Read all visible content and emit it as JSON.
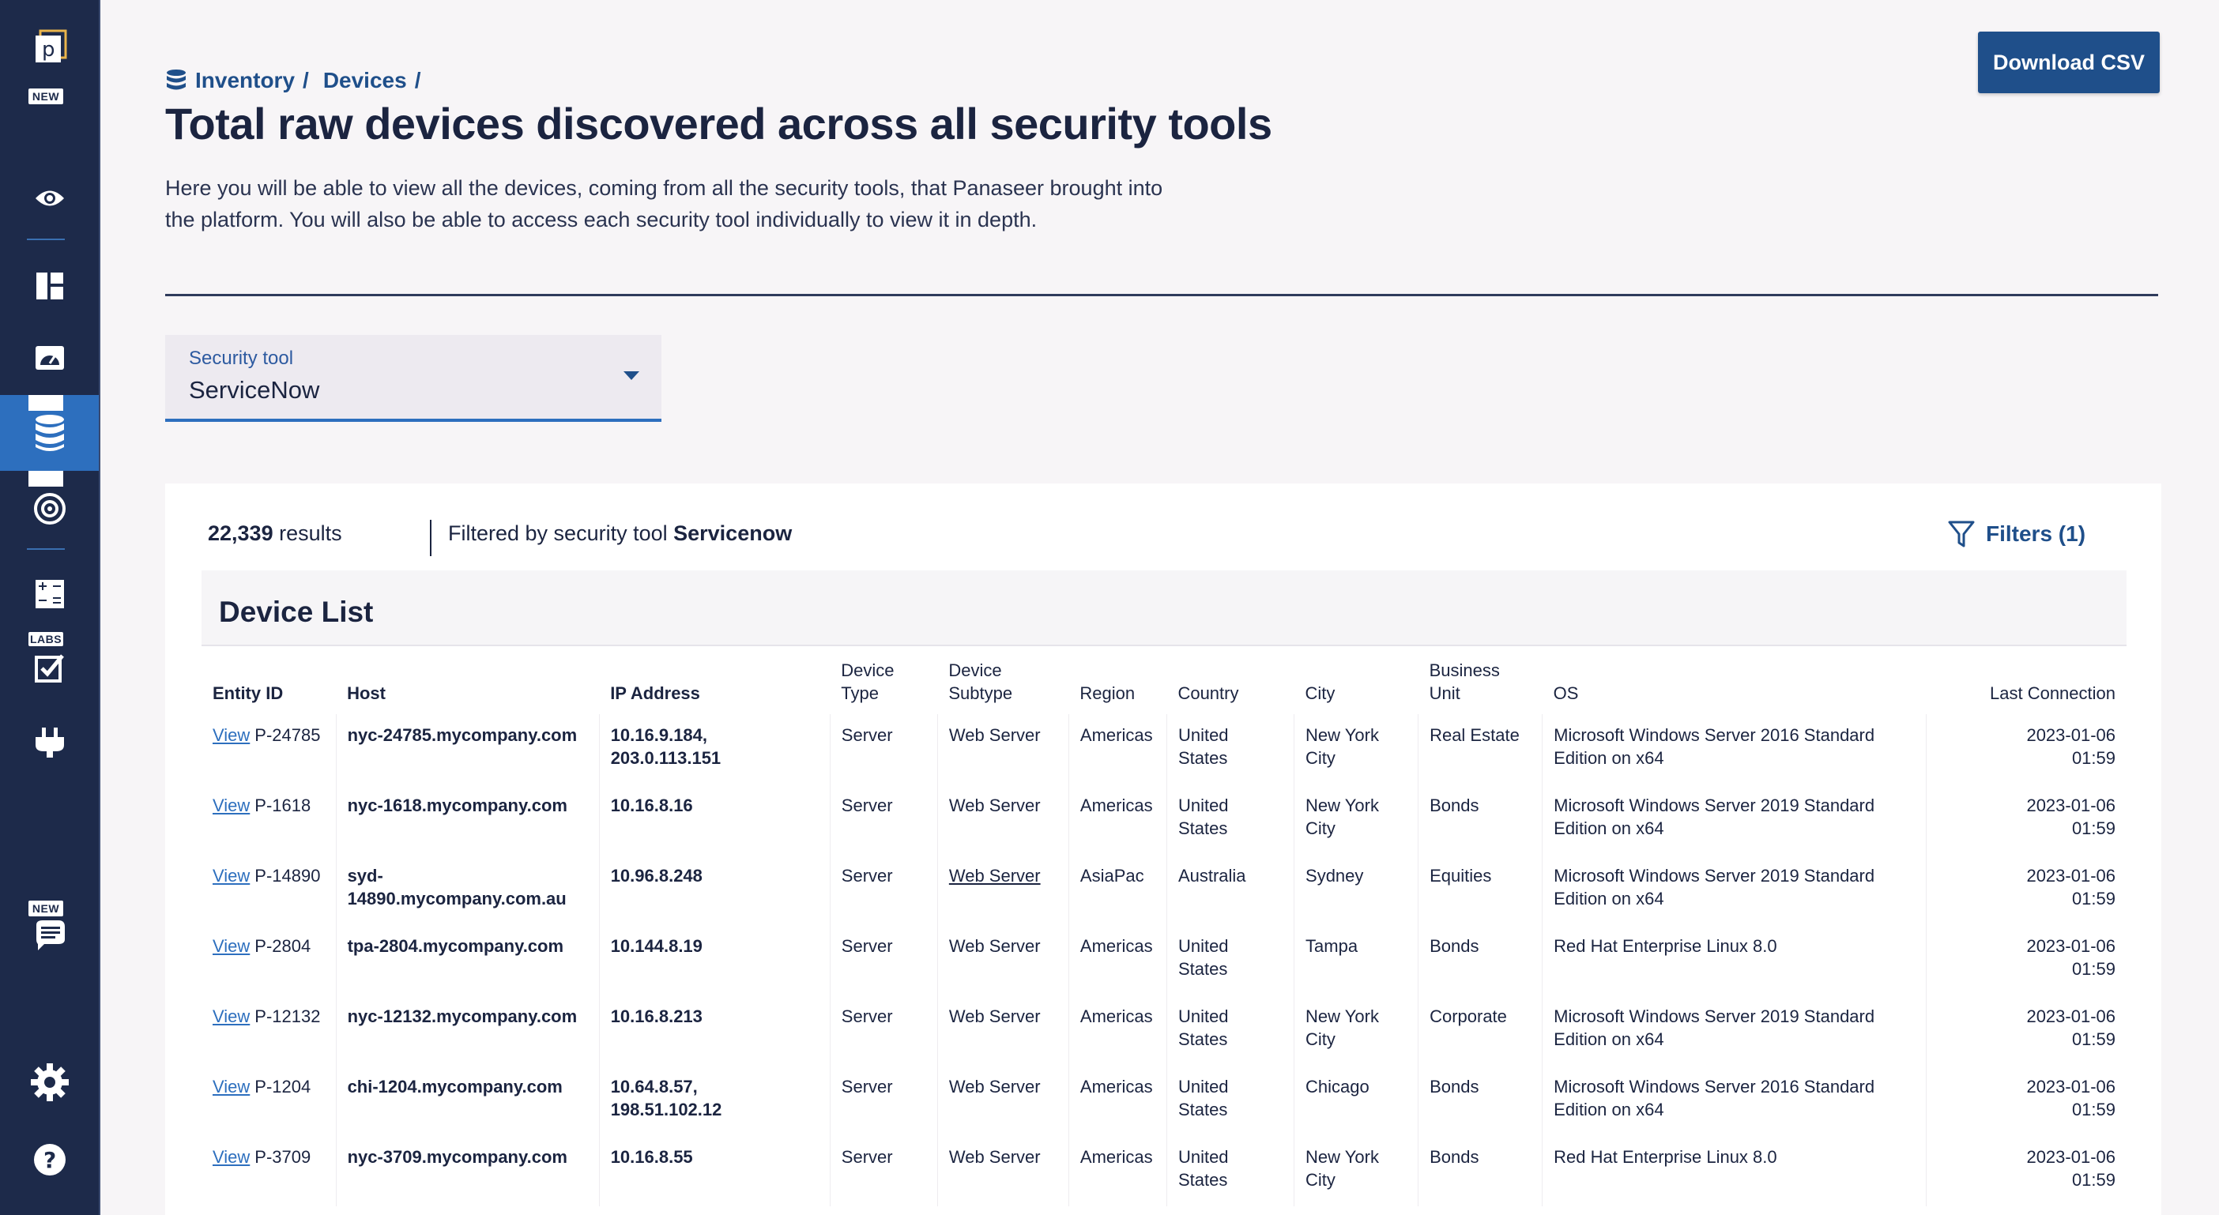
{
  "sidebar": {
    "logo_letter": "p",
    "badges": {
      "new_top": "NEW",
      "labs": "LABS",
      "new_bottom": "NEW"
    },
    "items": [
      {
        "icon": "eye-icon"
      },
      {
        "icon": "dashboard-icon"
      },
      {
        "icon": "gauge-icon"
      },
      {
        "icon": "database-icon",
        "active": true
      },
      {
        "icon": "target-icon"
      },
      {
        "icon": "calculator-icon"
      },
      {
        "icon": "checklist-icon"
      },
      {
        "icon": "plug-icon"
      },
      {
        "icon": "chat-icon"
      },
      {
        "icon": "gear-icon"
      },
      {
        "icon": "help-icon"
      }
    ]
  },
  "breadcrumb": {
    "item1": "Inventory",
    "item2": "Devices",
    "sep": "/"
  },
  "page": {
    "title": "Total raw devices discovered across all security tools",
    "description": "Here you will be able to view all the devices, coming from all the security tools, that Panaseer brought into the platform. You will also be able to access each security tool individually to view it in depth."
  },
  "download_button": "Download CSV",
  "security_tool_select": {
    "label": "Security tool",
    "value": "ServiceNow"
  },
  "results": {
    "count": "22,339",
    "count_suffix": "results",
    "filter_prefix": "Filtered by security tool",
    "filter_value": "Servicenow",
    "filters_button": "Filters (1)"
  },
  "device_list": {
    "title": "Device List",
    "columns": {
      "entity_id": "Entity ID",
      "host": "Host",
      "ip": "IP Address",
      "type_1": "Device",
      "type_2": "Type",
      "subtype_1": "Device",
      "subtype_2": "Subtype",
      "region": "Region",
      "country": "Country",
      "city": "City",
      "bu_1": "Business",
      "bu_2": "Unit",
      "os": "OS",
      "last": "Last Connection"
    },
    "view_label": "View",
    "rows": [
      {
        "id": "P-24785",
        "host": "nyc-24785.mycompany.com",
        "ip1": "10.16.9.184,",
        "ip2": "203.0.113.151",
        "type": "Server",
        "subtype": "Web Server",
        "region": "Americas",
        "country1": "United",
        "country2": "States",
        "city1": "New York",
        "city2": "City",
        "bu": "Real Estate",
        "os1": "Microsoft Windows Server 2016 Standard",
        "os2": "Edition on x64",
        "date": "2023-01-06",
        "time": "01:59"
      },
      {
        "id": "P-1618",
        "host": "nyc-1618.mycompany.com",
        "ip1": "10.16.8.16",
        "ip2": "",
        "type": "Server",
        "subtype": "Web Server",
        "region": "Americas",
        "country1": "United",
        "country2": "States",
        "city1": "New York",
        "city2": "City",
        "bu": "Bonds",
        "os1": "Microsoft Windows Server 2019 Standard",
        "os2": "Edition on x64",
        "date": "2023-01-06",
        "time": "01:59"
      },
      {
        "id": "P-14890",
        "host1": "syd-",
        "host2": "14890.mycompany.com.au",
        "ip1": "10.96.8.248",
        "ip2": "",
        "type": "Server",
        "subtype": "Web Server",
        "region": "AsiaPac",
        "country1": "Australia",
        "country2": "",
        "city1": "Sydney",
        "city2": "",
        "bu": "Equities",
        "os1": "Microsoft Windows Server 2019 Standard",
        "os2": "Edition on x64",
        "date": "2023-01-06",
        "time": "01:59"
      },
      {
        "id": "P-2804",
        "host": "tpa-2804.mycompany.com",
        "ip1": "10.144.8.19",
        "ip2": "",
        "type": "Server",
        "subtype": "Web Server",
        "region": "Americas",
        "country1": "United",
        "country2": "States",
        "city1": "Tampa",
        "city2": "",
        "bu": "Bonds",
        "os1": "Red Hat Enterprise Linux 8.0",
        "os2": "",
        "date": "2023-01-06",
        "time": "01:59"
      },
      {
        "id": "P-12132",
        "host": "nyc-12132.mycompany.com",
        "ip1": "10.16.8.213",
        "ip2": "",
        "type": "Server",
        "subtype": "Web Server",
        "region": "Americas",
        "country1": "United",
        "country2": "States",
        "city1": "New York",
        "city2": "City",
        "bu": "Corporate",
        "os1": "Microsoft Windows Server 2019 Standard",
        "os2": "Edition on x64",
        "date": "2023-01-06",
        "time": "01:59"
      },
      {
        "id": "P-1204",
        "host": "chi-1204.mycompany.com",
        "ip1": "10.64.8.57,",
        "ip2": "198.51.102.12",
        "type": "Server",
        "subtype": "Web Server",
        "region": "Americas",
        "country1": "United",
        "country2": "States",
        "city1": "Chicago",
        "city2": "",
        "bu": "Bonds",
        "os1": "Microsoft Windows Server 2016 Standard",
        "os2": "Edition on x64",
        "date": "2023-01-06",
        "time": "01:59"
      },
      {
        "id": "P-3709",
        "host": "nyc-3709.mycompany.com",
        "ip1": "10.16.8.55",
        "ip2": "",
        "type": "Server",
        "subtype": "Web Server",
        "region": "Americas",
        "country1": "United",
        "country2": "States",
        "city1": "New York",
        "city2": "City",
        "bu": "Bonds",
        "os1": "Red Hat Enterprise Linux 8.0",
        "os2": "",
        "date": "2023-01-06",
        "time": "01:59"
      }
    ]
  }
}
